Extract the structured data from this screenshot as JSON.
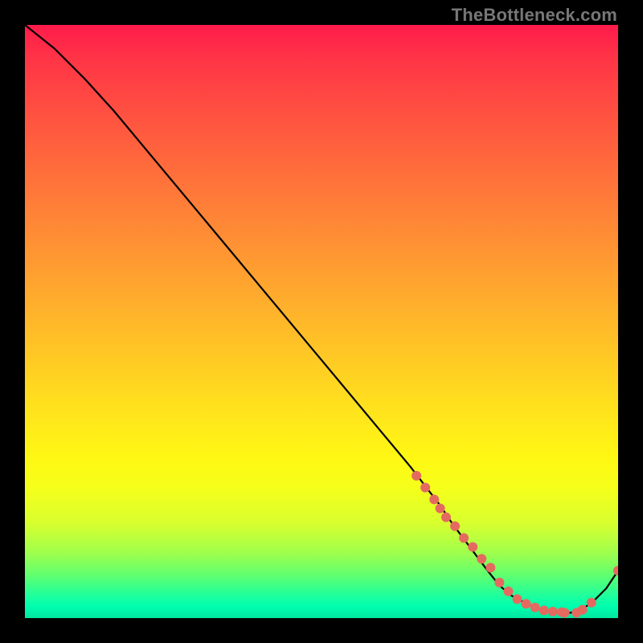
{
  "watermark": "TheBottleneck.com",
  "chart_data": {
    "type": "line",
    "title": "",
    "xlabel": "",
    "ylabel": "",
    "ylim": [
      0,
      100
    ],
    "xlim": [
      0,
      100
    ],
    "series": [
      {
        "name": "curve",
        "x": [
          0,
          5,
          10,
          15,
          20,
          25,
          30,
          35,
          40,
          45,
          50,
          55,
          60,
          65,
          70,
          72,
          75,
          78,
          80,
          82,
          85,
          88,
          90,
          92,
          94,
          96,
          98,
          100
        ],
        "y": [
          100,
          96,
          91,
          85.5,
          79.5,
          73.5,
          67.5,
          61.5,
          55.5,
          49.5,
          43.5,
          37.5,
          31.5,
          25.5,
          19,
          16,
          12,
          8,
          5.5,
          3.8,
          2.2,
          1.2,
          0.9,
          0.9,
          1.5,
          3,
          5,
          8
        ]
      }
    ],
    "markers": {
      "name": "dots",
      "color": "#e46a60",
      "x": [
        66,
        67.5,
        69,
        70,
        71,
        72.5,
        74,
        75.5,
        77,
        78.5,
        80,
        81.5,
        83,
        84.5,
        86,
        87.5,
        89,
        90.5,
        91,
        93,
        94,
        95.5,
        100
      ],
      "y": [
        24,
        22,
        20,
        18.5,
        17,
        15.5,
        13.5,
        12,
        10,
        8.5,
        6,
        4.5,
        3.2,
        2.4,
        1.8,
        1.3,
        1.1,
        1.0,
        0.9,
        0.9,
        1.4,
        2.6,
        8
      ]
    }
  }
}
